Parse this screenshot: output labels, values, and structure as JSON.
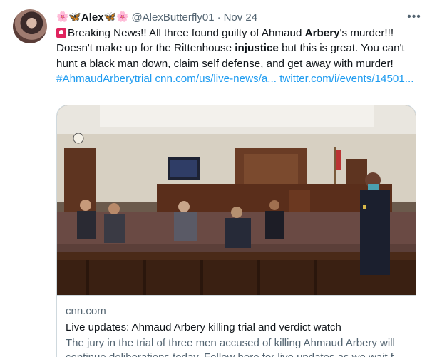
{
  "author": {
    "emoji_left": "🌸🦋",
    "name": "Alex",
    "emoji_right": "🦋🌸",
    "handle": "@AlexButterfly01",
    "separator": "·",
    "date": "Nov 24",
    "avatar_icon": "profile-photo"
  },
  "more_label": "•••",
  "tweet": {
    "part1": "Breaking News!! All three found guilty of Ahmaud ",
    "bold1": "Arbery",
    "part2": "'s murder!!! Doesn't make up for the Rittenhouse ",
    "bold2": "injustice",
    "part3": " but this is great. You can't hunt a black man down, claim self defense, and get away with murder!",
    "hashtag": "#AhmaudArberytrial",
    "link1": "cnn.com/us/live-news/a...",
    "link2": "twitter.com/i/events/14501..."
  },
  "card": {
    "image_icon": "courtroom-photo",
    "domain": "cnn.com",
    "title": "Live updates: Ahmaud Arbery killing trial and verdict watch",
    "description": "The jury in the trial of three men accused of killing Ahmaud Arbery will continue deliberations today. Follow here for live updates as we wait f..."
  },
  "colors": {
    "link": "#1d9bf0",
    "text": "#0f1419",
    "secondary": "#536471",
    "border": "#cfd9de",
    "siren": "#e0245e"
  }
}
